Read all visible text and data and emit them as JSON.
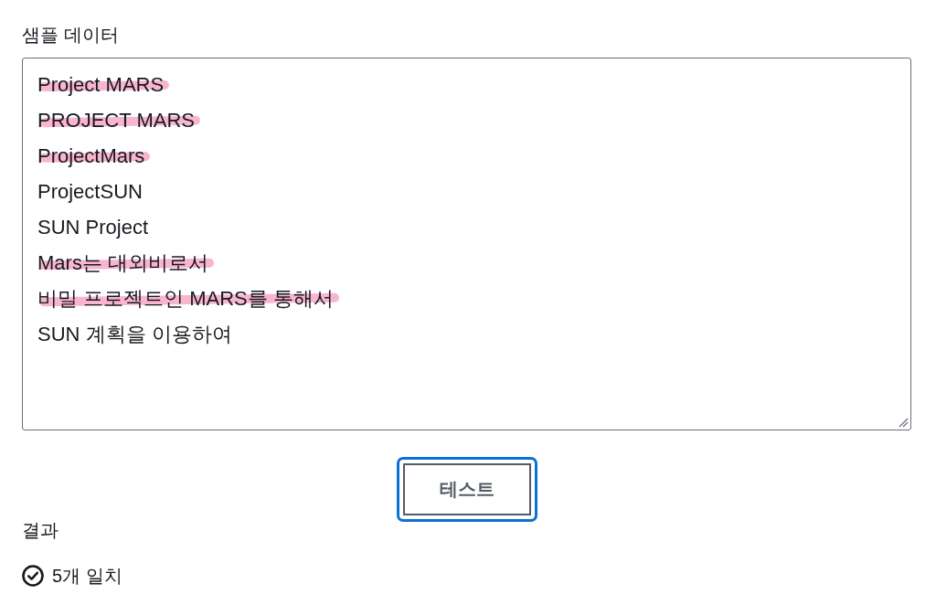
{
  "sample_data": {
    "label": "샘플 데이터",
    "lines": [
      {
        "text": "Project MARS",
        "highlighted": true
      },
      {
        "text": "PROJECT MARS",
        "highlighted": true
      },
      {
        "text": "ProjectMars",
        "highlighted": true
      },
      {
        "text": "ProjectSUN",
        "highlighted": false
      },
      {
        "text": "SUN Project",
        "highlighted": false
      },
      {
        "text": "Mars는 대외비로서",
        "highlighted": true
      },
      {
        "text": "비밀 프로젝트인 MARS를 통해서",
        "highlighted": true
      },
      {
        "text": "SUN 계획을 이용하여",
        "highlighted": false
      }
    ]
  },
  "test_button": {
    "label": "테스트",
    "focused": true
  },
  "result": {
    "label": "결과",
    "summary": "5개 일치"
  }
}
